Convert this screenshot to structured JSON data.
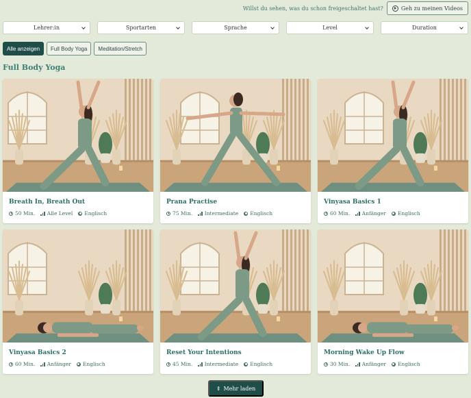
{
  "header": {
    "hint_text": "Willst du sehen, was du schon freigeschaltet hast?",
    "my_videos_label": "Geh zu meinen Videos"
  },
  "filters": [
    {
      "label": "Lehrer:in"
    },
    {
      "label": "Sportarten"
    },
    {
      "label": "Sprache"
    },
    {
      "label": "Level"
    },
    {
      "label": "Duration"
    }
  ],
  "chips": [
    {
      "label": "Alle anzeigen",
      "active": true
    },
    {
      "label": "Full Body Yoga",
      "active": false
    },
    {
      "label": "Meditation/Stretch",
      "active": false
    }
  ],
  "section": {
    "title": "Full Body Yoga"
  },
  "videos": [
    {
      "title": "Breath In, Breath Out",
      "duration": "50 Min.",
      "level": "Alle Level",
      "language": "Englisch",
      "pose": "lunge-arms-up"
    },
    {
      "title": "Prana Practise",
      "duration": "75 Min.",
      "level": "Intermediate",
      "language": "Englisch",
      "pose": "warrior-two"
    },
    {
      "title": "Vinyasa Basics 1",
      "duration": "60 Min.",
      "level": "Anfänger",
      "language": "Englisch",
      "pose": "lunge-arms-up"
    },
    {
      "title": "Vinyasa Basics 2",
      "duration": "60 Min.",
      "level": "Anfänger",
      "language": "Englisch",
      "pose": "lying-down"
    },
    {
      "title": "Reset Your Intentions",
      "duration": "45 Min.",
      "level": "Intermediate",
      "language": "Englisch",
      "pose": "lunge-arms-up"
    },
    {
      "title": "Morning Wake Up Flow",
      "duration": "30 Min.",
      "level": "Anfänger",
      "language": "Englisch",
      "pose": "lying-down"
    }
  ],
  "load_more": {
    "label": "Mehr laden"
  },
  "colors": {
    "accent": "#1f4d47",
    "background": "#e3ead9",
    "title": "#2d6f63"
  }
}
